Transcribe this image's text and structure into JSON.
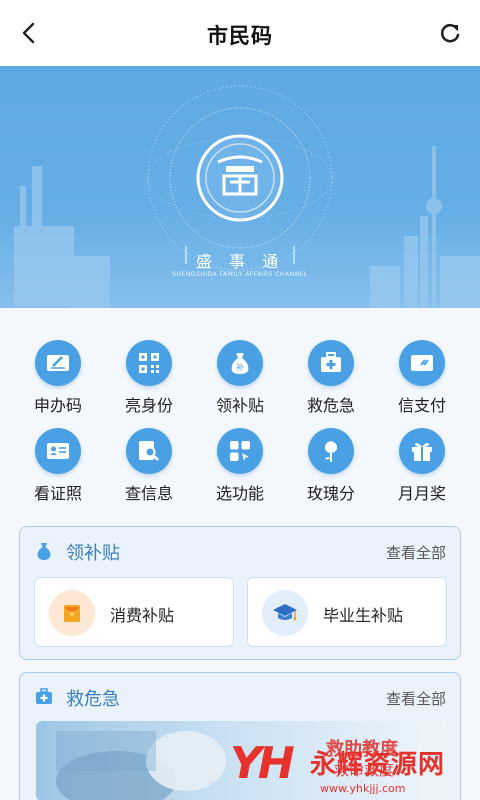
{
  "header": {
    "title": "市民码"
  },
  "banner": {
    "brand": "盛 事 通",
    "brand_sub": "SHENGSHIDA FAMILY AFFAIRS CHANNEL"
  },
  "services": [
    {
      "label": "申办码",
      "icon": "card-edit-icon"
    },
    {
      "label": "亮身份",
      "icon": "qrcode-icon"
    },
    {
      "label": "领补贴",
      "icon": "money-bag-icon"
    },
    {
      "label": "救危急",
      "icon": "first-aid-kit-icon"
    },
    {
      "label": "信支付",
      "icon": "payment-card-icon"
    },
    {
      "label": "看证照",
      "icon": "id-card-icon"
    },
    {
      "label": "查信息",
      "icon": "search-document-icon"
    },
    {
      "label": "选功能",
      "icon": "apps-grid-icon"
    },
    {
      "label": "玫瑰分",
      "icon": "rose-icon"
    },
    {
      "label": "月月奖",
      "icon": "gift-icon"
    }
  ],
  "subsidy_card": {
    "title": "领补贴",
    "more": "查看全部",
    "items": [
      {
        "label": "消费补贴",
        "icon": "red-envelope-icon"
      },
      {
        "label": "毕业生补贴",
        "icon": "graduation-cap-icon"
      }
    ]
  },
  "emergency_card": {
    "title": "救危急",
    "more": "查看全部",
    "image_text": "救助教度",
    "image_text2": "救命救度"
  },
  "watermark": {
    "logo": "YH",
    "name": "永辉资源网",
    "url": "www.yhkjjj.com"
  }
}
